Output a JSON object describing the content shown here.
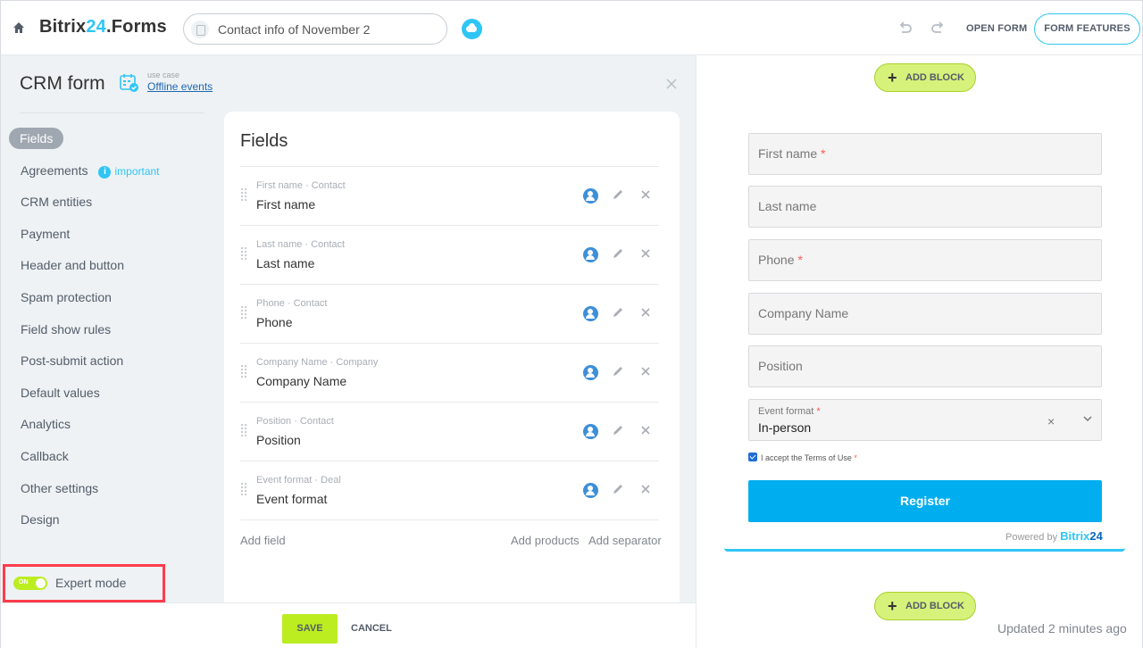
{
  "header": {
    "brand_prefix": "Bitrix",
    "brand_num": "24",
    "brand_suffix": ".Forms",
    "form_title": "Contact info of November 2",
    "open_form": "OPEN FORM",
    "form_features": "FORM FEATURES"
  },
  "sidebar": {
    "title": "CRM form",
    "use_case_small": "use case",
    "use_case_link": "Offline events",
    "items": [
      {
        "label": "Fields"
      },
      {
        "label": "Agreements",
        "badge": "important"
      },
      {
        "label": "CRM entities"
      },
      {
        "label": "Payment"
      },
      {
        "label": "Header and button"
      },
      {
        "label": "Spam protection"
      },
      {
        "label": "Field show rules"
      },
      {
        "label": "Post-submit action"
      },
      {
        "label": "Default values"
      },
      {
        "label": "Analytics"
      },
      {
        "label": "Callback"
      },
      {
        "label": "Other settings"
      },
      {
        "label": "Design"
      }
    ],
    "expert_mode": "Expert mode",
    "toggle_on": "ON"
  },
  "fields_panel": {
    "title": "Fields",
    "rows": [
      {
        "meta": "First name · Contact",
        "name": "First name"
      },
      {
        "meta": "Last name · Contact",
        "name": "Last name"
      },
      {
        "meta": "Phone · Contact",
        "name": "Phone"
      },
      {
        "meta": "Company Name · Company",
        "name": "Company Name"
      },
      {
        "meta": "Position · Contact",
        "name": "Position"
      },
      {
        "meta": "Event format · Deal",
        "name": "Event format"
      }
    ],
    "add_field": "Add field",
    "add_products": "Add products",
    "add_separator": "Add separator"
  },
  "footer": {
    "save": "SAVE",
    "cancel": "CANCEL"
  },
  "preview": {
    "add_block": "ADD BLOCK",
    "inputs": [
      {
        "label": "First name",
        "required": "*"
      },
      {
        "label": "Last name",
        "required": ""
      },
      {
        "label": "Phone",
        "required": "*"
      },
      {
        "label": "Company Name",
        "required": ""
      },
      {
        "label": "Position",
        "required": ""
      }
    ],
    "event_format_label": "Event format",
    "event_format_required": "*",
    "event_format_value": "In-person",
    "event_format_clear": "×",
    "terms": "I accept the Terms of Use",
    "terms_required": "*",
    "register": "Register",
    "powered_by": "Powered by",
    "powered_brand": "Bitrix",
    "powered_num": "24",
    "updated": "Updated 2 minutes ago"
  },
  "colors": {
    "accent_blue": "#2fc6f6",
    "accent_green": "#bbed21",
    "register_blue": "#00aeef",
    "highlight_red": "#ff3c4b"
  }
}
